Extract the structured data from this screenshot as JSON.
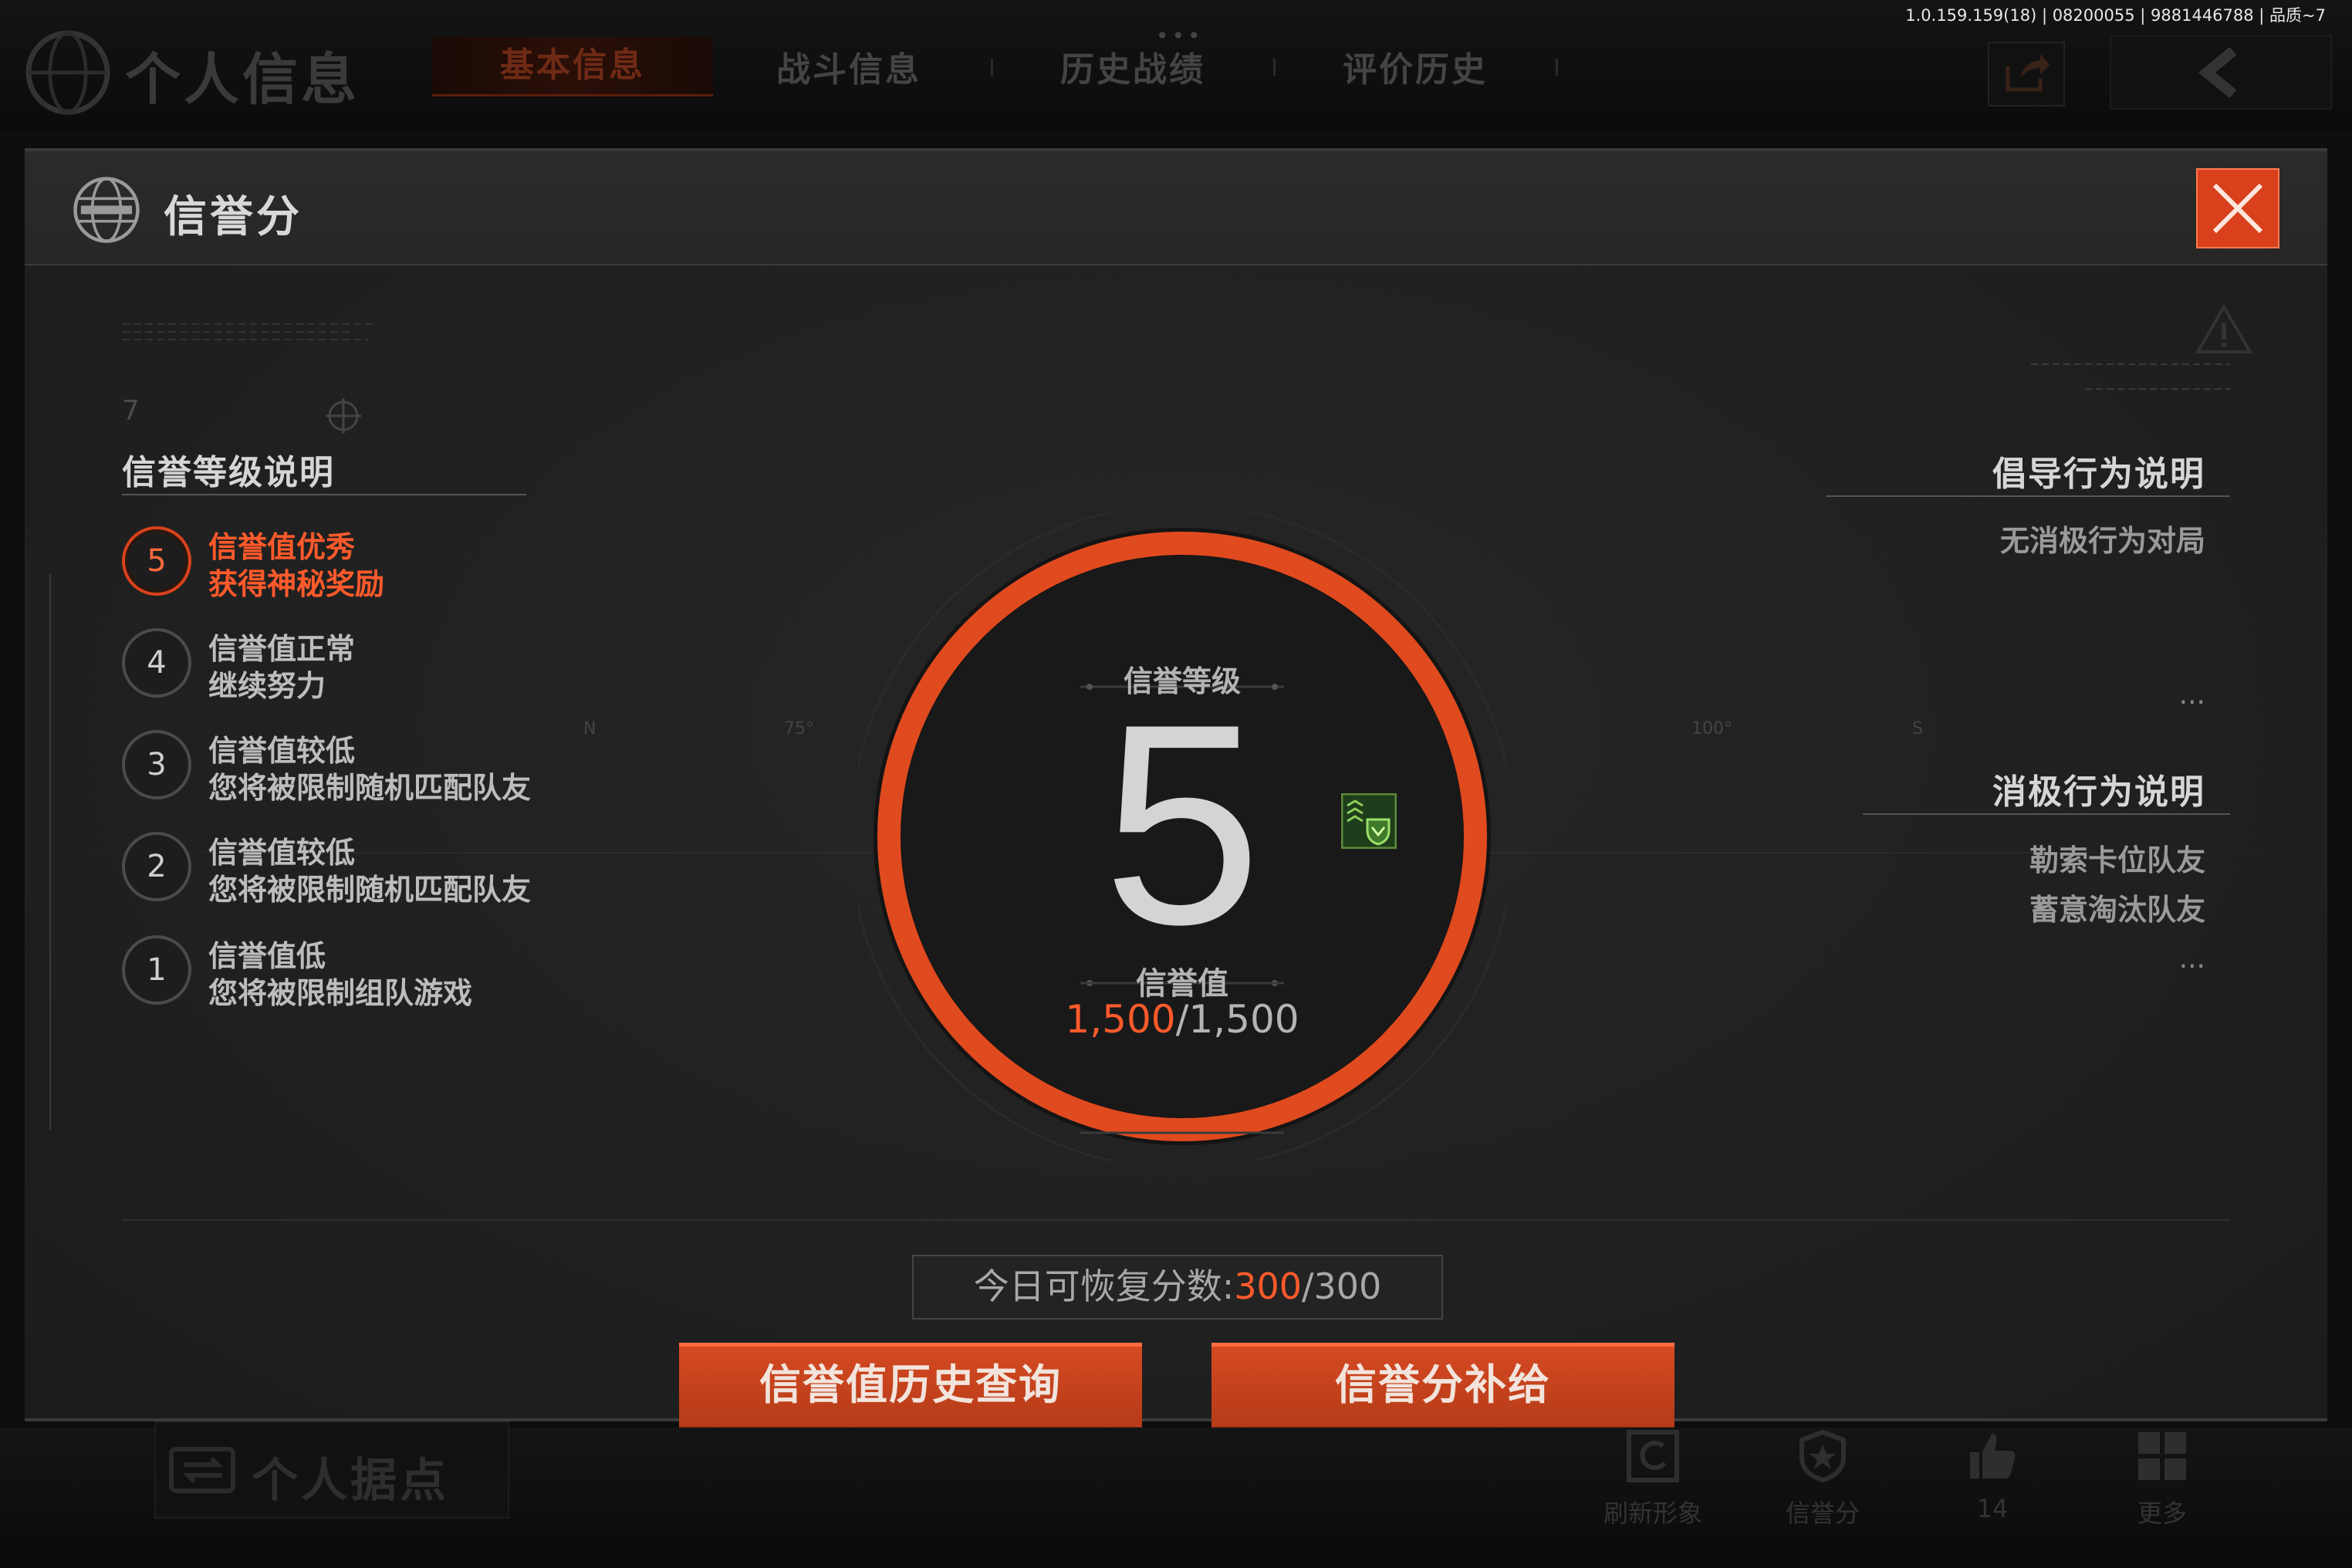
{
  "version": "1.0.159.159(18) | 08200055 | 9881446788 | 品质~7",
  "header": {
    "page_title": "个人信息",
    "tabs": [
      {
        "label": "基本信息",
        "active": true
      },
      {
        "label": "战斗信息"
      },
      {
        "label": "历史战绩"
      },
      {
        "label": "评价历史"
      }
    ],
    "more": "•••"
  },
  "modal": {
    "title": "信誉分",
    "left": {
      "deco_number": "7",
      "title": "信誉等级说明",
      "levels": [
        {
          "num": "5",
          "line1": "信誉值优秀",
          "line2": "获得神秘奖励",
          "active": true
        },
        {
          "num": "4",
          "line1": "信誉值正常",
          "line2": "继续努力"
        },
        {
          "num": "3",
          "line1": "信誉值较低",
          "line2": "您将被限制随机匹配队友"
        },
        {
          "num": "2",
          "line1": "信誉值较低",
          "line2": "您将被限制随机匹配队友"
        },
        {
          "num": "1",
          "line1": "信誉值低",
          "line2": "您将被限制组队游戏"
        }
      ]
    },
    "center": {
      "grade_label": "信誉等级",
      "grade": "5",
      "score_label": "信誉值",
      "score_current": "1,500",
      "score_sep": "/",
      "score_max": "1,500",
      "axis_labels": [
        "N",
        "75°",
        "100°",
        "S"
      ]
    },
    "right": {
      "positive_title": "倡导行为说明",
      "positive_items": [
        "无消极行为对局"
      ],
      "negative_title": "消极行为说明",
      "negative_items": [
        "勒索卡位队友",
        "蓄意淘汰队友"
      ],
      "more": "..."
    },
    "recover": {
      "label": "今日可恢复分数:",
      "current": "300",
      "sep": "/",
      "max": "300"
    },
    "buttons": {
      "history": "信誉值历史查询",
      "refill": "信誉分补给"
    }
  },
  "dock": {
    "base_label": "个人据点",
    "items": [
      {
        "label": "刷新形象",
        "icon": "refresh-icon"
      },
      {
        "label": "信誉分",
        "icon": "shield-badge-icon"
      },
      {
        "label": "14",
        "icon": "thumbs-up-icon"
      },
      {
        "label": "更多",
        "icon": "grid-icon"
      }
    ]
  },
  "colors": {
    "accent": "#d8411c",
    "highlight": "#ff5a2b",
    "panel": "#232323"
  }
}
